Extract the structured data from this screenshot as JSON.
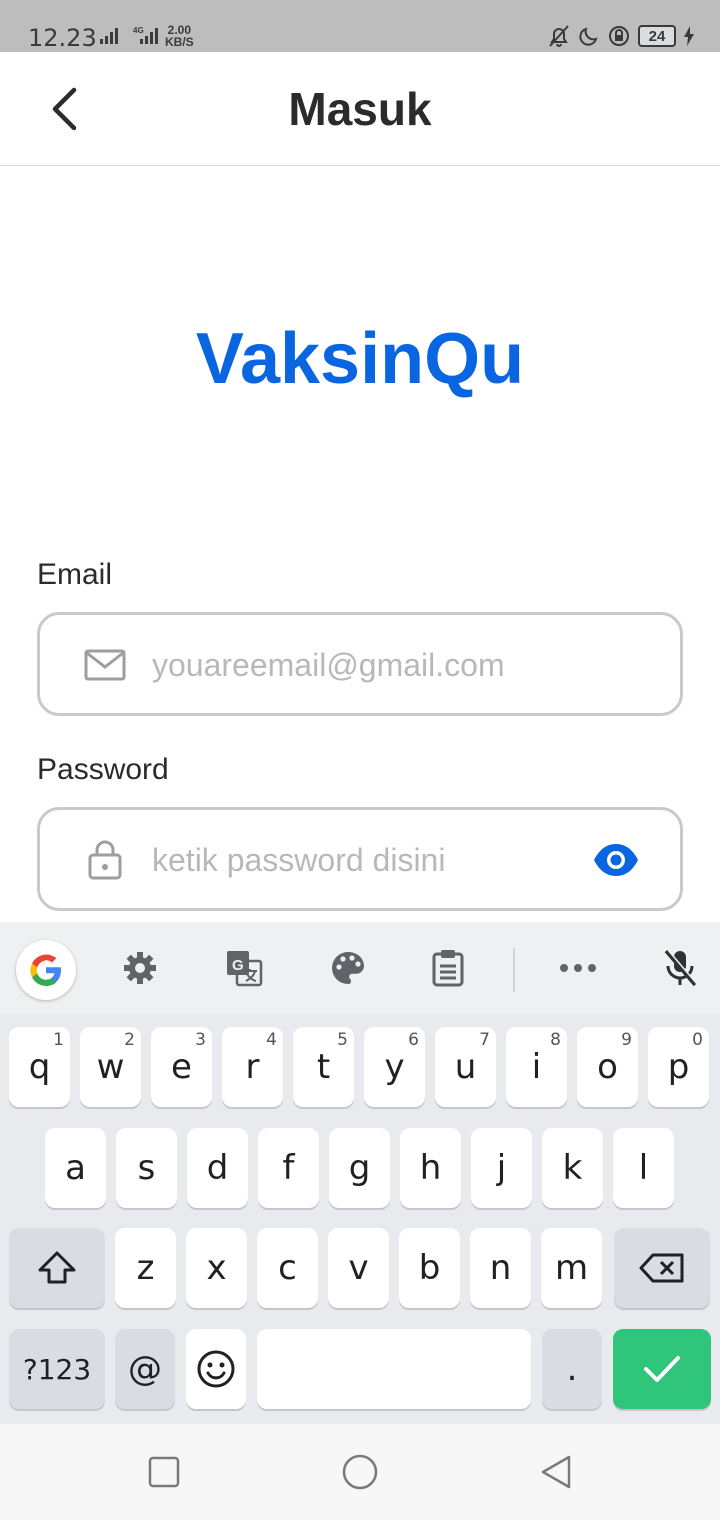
{
  "status_bar": {
    "time": "12.23",
    "network": "4G",
    "speed_value": "2.00",
    "speed_unit": "KB/S",
    "battery": "24",
    "icons": [
      "signal-icon",
      "mute-icon",
      "moon-icon",
      "lock-rotation-icon",
      "battery-icon",
      "charging-icon"
    ]
  },
  "app_bar": {
    "title": "Masuk",
    "back_icon": "back-arrow-icon"
  },
  "brand": {
    "name": "VaksinQu",
    "color": "#0a66e0"
  },
  "form": {
    "email": {
      "label": "Email",
      "placeholder": "youareemail@gmail.com",
      "value": "",
      "icon": "mail-icon"
    },
    "password": {
      "label": "Password",
      "placeholder": "ketik password disini",
      "value": "",
      "icon": "lock-icon",
      "toggle_icon": "eye-icon"
    }
  },
  "keyboard": {
    "toolbar": [
      "google-icon",
      "settings-icon",
      "translate-icon",
      "palette-icon",
      "clipboard-icon",
      "more-icon",
      "mic-off-icon"
    ],
    "row1": [
      {
        "key": "q",
        "hint": "1"
      },
      {
        "key": "w",
        "hint": "2"
      },
      {
        "key": "e",
        "hint": "3"
      },
      {
        "key": "r",
        "hint": "4"
      },
      {
        "key": "t",
        "hint": "5"
      },
      {
        "key": "y",
        "hint": "6"
      },
      {
        "key": "u",
        "hint": "7"
      },
      {
        "key": "i",
        "hint": "8"
      },
      {
        "key": "o",
        "hint": "9"
      },
      {
        "key": "p",
        "hint": "0"
      }
    ],
    "row2": [
      "a",
      "s",
      "d",
      "f",
      "g",
      "h",
      "j",
      "k",
      "l"
    ],
    "row3": [
      "z",
      "x",
      "c",
      "v",
      "b",
      "n",
      "m"
    ],
    "row4": {
      "symbols": "?123",
      "at": "@",
      "period": "."
    },
    "enter_color": "#2fc57a"
  },
  "nav_bar": [
    "recent-apps-icon",
    "home-icon",
    "back-icon"
  ]
}
